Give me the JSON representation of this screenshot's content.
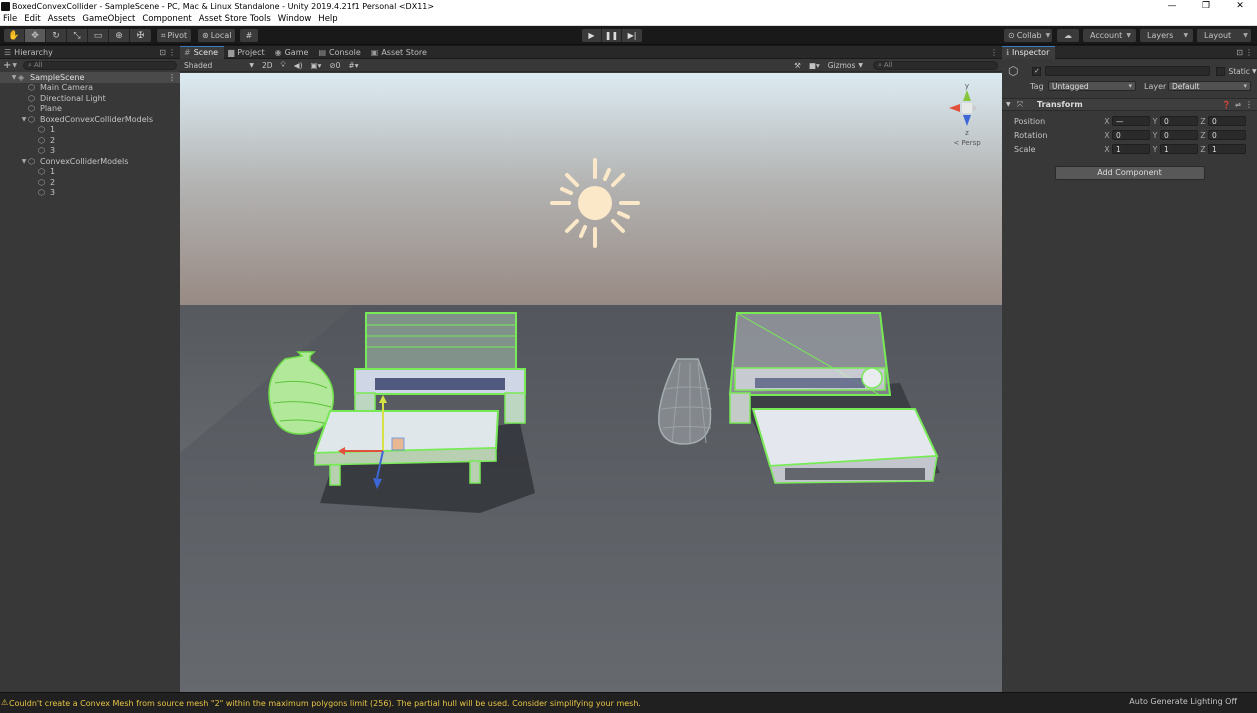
{
  "window": {
    "title": "BoxedConvexCollider - SampleScene - PC, Mac & Linux Standalone - Unity 2019.4.21f1 Personal <DX11>",
    "minimize": "—",
    "maximize": "❐",
    "close": "✕"
  },
  "menu": [
    "File",
    "Edit",
    "Assets",
    "GameObject",
    "Component",
    "Asset Store Tools",
    "Window",
    "Help"
  ],
  "toolbar": {
    "tools": [
      "✋",
      "✥",
      "↻",
      "⤡",
      "▭",
      "⊕",
      "✠"
    ],
    "pivot": "Pivot",
    "local": "Local",
    "collab": "Collab",
    "account": "Account",
    "layers": "Layers",
    "layout": "Layout"
  },
  "hierarchy": {
    "tab": "Hierarchy",
    "search_placeholder": "All",
    "items": [
      {
        "label": "SampleScene",
        "depth": 0,
        "kind": "scene"
      },
      {
        "label": "Main Camera",
        "depth": 1,
        "kind": "object"
      },
      {
        "label": "Directional Light",
        "depth": 1,
        "kind": "object"
      },
      {
        "label": "Plane",
        "depth": 1,
        "kind": "object"
      },
      {
        "label": "BoxedConvexColliderModels",
        "depth": 1,
        "kind": "group"
      },
      {
        "label": "1",
        "depth": 2,
        "kind": "object"
      },
      {
        "label": "2",
        "depth": 2,
        "kind": "object"
      },
      {
        "label": "3",
        "depth": 2,
        "kind": "object"
      },
      {
        "label": "ConvexColliderModels",
        "depth": 1,
        "kind": "group"
      },
      {
        "label": "1",
        "depth": 2,
        "kind": "object"
      },
      {
        "label": "2",
        "depth": 2,
        "kind": "object"
      },
      {
        "label": "3",
        "depth": 2,
        "kind": "object"
      }
    ]
  },
  "scene_tabs": [
    {
      "label": "Scene",
      "icon": "#",
      "active": true
    },
    {
      "label": "Project",
      "icon": "▆",
      "active": false
    },
    {
      "label": "Game",
      "icon": "◉",
      "active": false
    },
    {
      "label": "Console",
      "icon": "▤",
      "active": false
    },
    {
      "label": "Asset Store",
      "icon": "▣",
      "active": false
    }
  ],
  "scene_toolbar": {
    "shading": "Shaded",
    "mode_2d": "2D",
    "gizmos": "Gizmos",
    "search_placeholder": "All"
  },
  "viewport": {
    "persp_label": "< Persp",
    "axis_y": "y",
    "axis_z": "z"
  },
  "inspector": {
    "tab": "Inspector",
    "static_label": "Static",
    "tag_label": "Tag",
    "tag_value": "Untagged",
    "layer_label": "Layer",
    "layer_value": "Default",
    "component_title": "Transform",
    "position_label": "Position",
    "rotation_label": "Rotation",
    "scale_label": "Scale",
    "position": {
      "x": "—",
      "y": "0",
      "z": "0"
    },
    "rotation": {
      "x": "0",
      "y": "0",
      "z": "0"
    },
    "scale": {
      "x": "1",
      "y": "1",
      "z": "1"
    },
    "add_component": "Add Component"
  },
  "status": {
    "message": "Couldn't create a Convex Mesh from source mesh \"2\" within the maximum polygons limit (256). The partial hull will be used. Consider simplifying your mesh.",
    "right": "Auto Generate Lighting Off"
  },
  "colors": {
    "accent": "#3a79bb",
    "collider_green": "#7dff5a",
    "warning": "#e8c545"
  }
}
